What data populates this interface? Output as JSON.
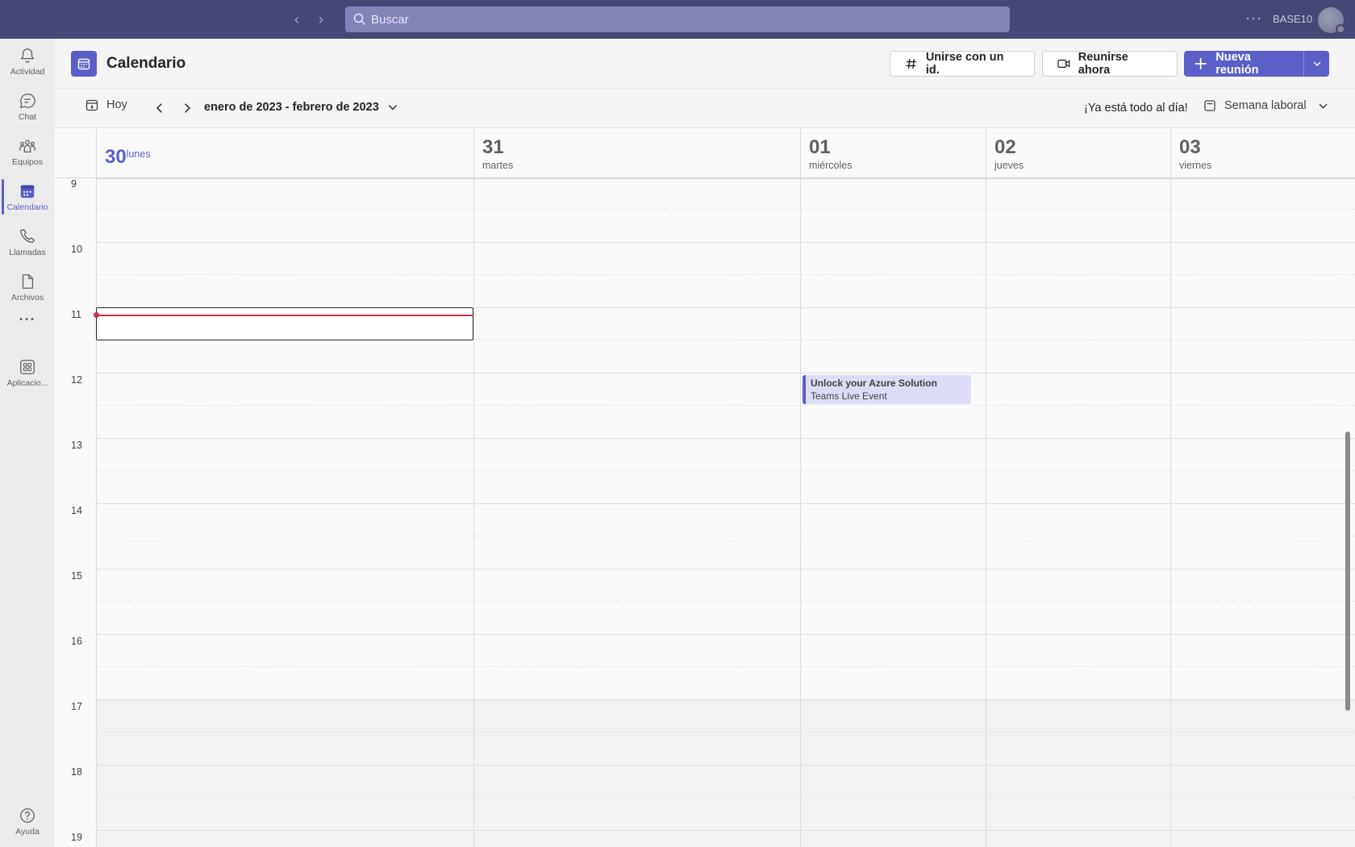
{
  "topbar": {
    "search_placeholder": "Buscar",
    "more": "···",
    "org": "BASE10"
  },
  "rail": {
    "items": [
      {
        "label": "Actividad",
        "icon": "bell-icon"
      },
      {
        "label": "Chat",
        "icon": "chat-icon"
      },
      {
        "label": "Equipos",
        "icon": "teams-icon"
      },
      {
        "label": "Calendario",
        "icon": "calendar-icon",
        "active": true
      },
      {
        "label": "Llamadas",
        "icon": "phone-icon"
      },
      {
        "label": "Archivos",
        "icon": "file-icon"
      },
      {
        "label": "···",
        "icon": "more-icon"
      },
      {
        "label": "Aplicacio...",
        "icon": "apps-icon"
      }
    ],
    "help": "Ayuda"
  },
  "header": {
    "title": "Calendario",
    "join_id": "Unirse con un id.",
    "meet_now": "Reunirse ahora",
    "new_meeting": "Nueva reunión"
  },
  "toolbar": {
    "today": "Hoy",
    "range": "enero de 2023 - febrero de 2023",
    "status": "¡Ya está todo al día!",
    "view": "Semana laboral"
  },
  "days": [
    {
      "num": "30",
      "name": "lunes",
      "today": true
    },
    {
      "num": "31",
      "name": "martes"
    },
    {
      "num": "01",
      "name": "miércoles"
    },
    {
      "num": "02",
      "name": "jueves"
    },
    {
      "num": "03",
      "name": "viernes"
    }
  ],
  "hours": [
    "9",
    "10",
    "11",
    "12",
    "13",
    "14",
    "15",
    "16",
    "17",
    "18",
    "19"
  ],
  "event": {
    "title": "Unlock your Azure Solution",
    "subtitle": "Teams Live Event"
  },
  "colors": {
    "brand": "#5b5fc7",
    "topbar": "#464775",
    "now_indicator": "#c4314b"
  }
}
